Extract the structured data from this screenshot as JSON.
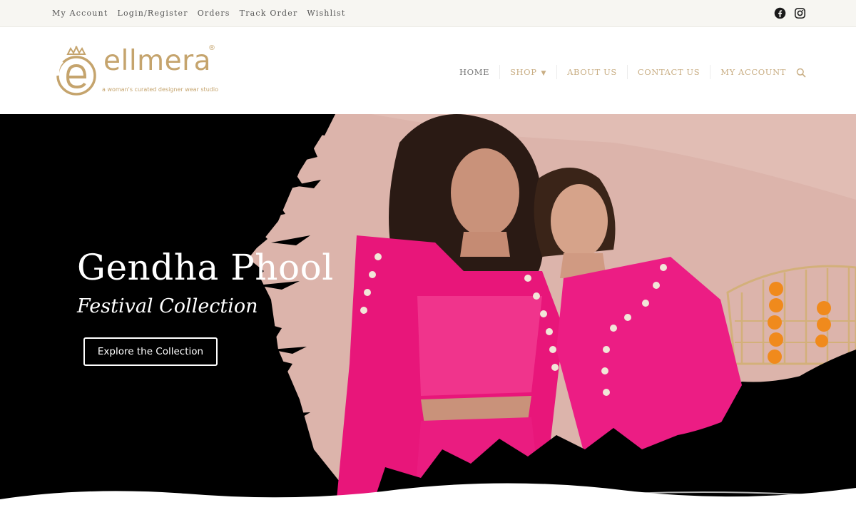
{
  "topbar": {
    "links": [
      "My Account",
      "Login/Register",
      "Orders",
      "Track Order",
      "Wishlist"
    ],
    "social_icons": [
      "facebook-icon",
      "instagram-icon"
    ]
  },
  "brand": {
    "name": "ellmera",
    "registered": "®",
    "tagline": "a woman's curated designer wear studio",
    "color": "#c5a46d"
  },
  "nav": {
    "home": "HOME",
    "shop": "SHOP",
    "about": "ABOUT US",
    "contact": "CONTACT US",
    "account": "MY ACCOUNT",
    "search_icon": "search-icon",
    "accent_color": "#c9ae84"
  },
  "hero": {
    "title": "Gendha Phool",
    "subtitle": "Festival Collection",
    "cta_label": "Explore the Collection",
    "accent_color": "#f0147d"
  }
}
